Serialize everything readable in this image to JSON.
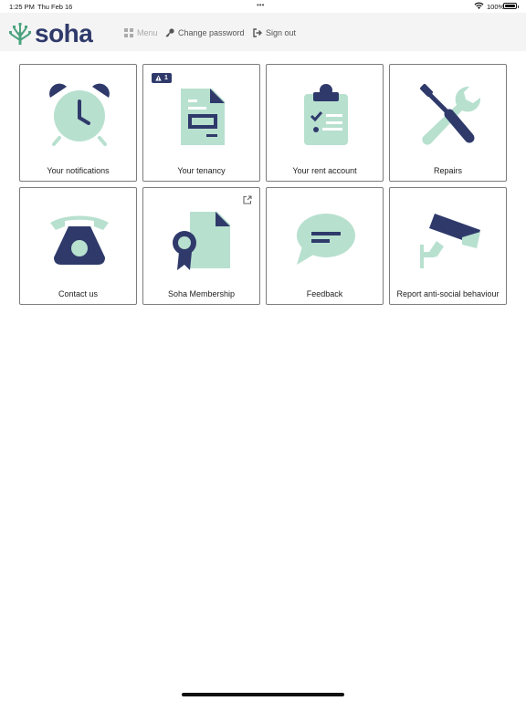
{
  "status_bar": {
    "time": "1:25 PM",
    "date": "Thu Feb 16",
    "dots": "•••",
    "battery": "100%"
  },
  "header": {
    "logo_text": "soha",
    "nav": {
      "menu": "Menu",
      "change_password": "Change password",
      "sign_out": "Sign out"
    }
  },
  "tiles": [
    {
      "label": "Your notifications",
      "icon": "alarm-clock-icon"
    },
    {
      "label": "Your tenancy",
      "icon": "document-icon",
      "badge": "1"
    },
    {
      "label": "Your rent account",
      "icon": "clipboard-checklist-icon"
    },
    {
      "label": "Repairs",
      "icon": "wrench-screwdriver-icon"
    },
    {
      "label": "Contact us",
      "icon": "telephone-icon"
    },
    {
      "label": "Soha Membership",
      "icon": "certificate-icon",
      "external": true
    },
    {
      "label": "Feedback",
      "icon": "speech-bubble-icon"
    },
    {
      "label": "Report anti-social behaviour",
      "icon": "cctv-camera-icon"
    }
  ],
  "colors": {
    "navy": "#2f3a6b",
    "mint": "#b8e0cf",
    "header_bg": "#f4f4f4",
    "tile_border": "#7d7d7d"
  }
}
